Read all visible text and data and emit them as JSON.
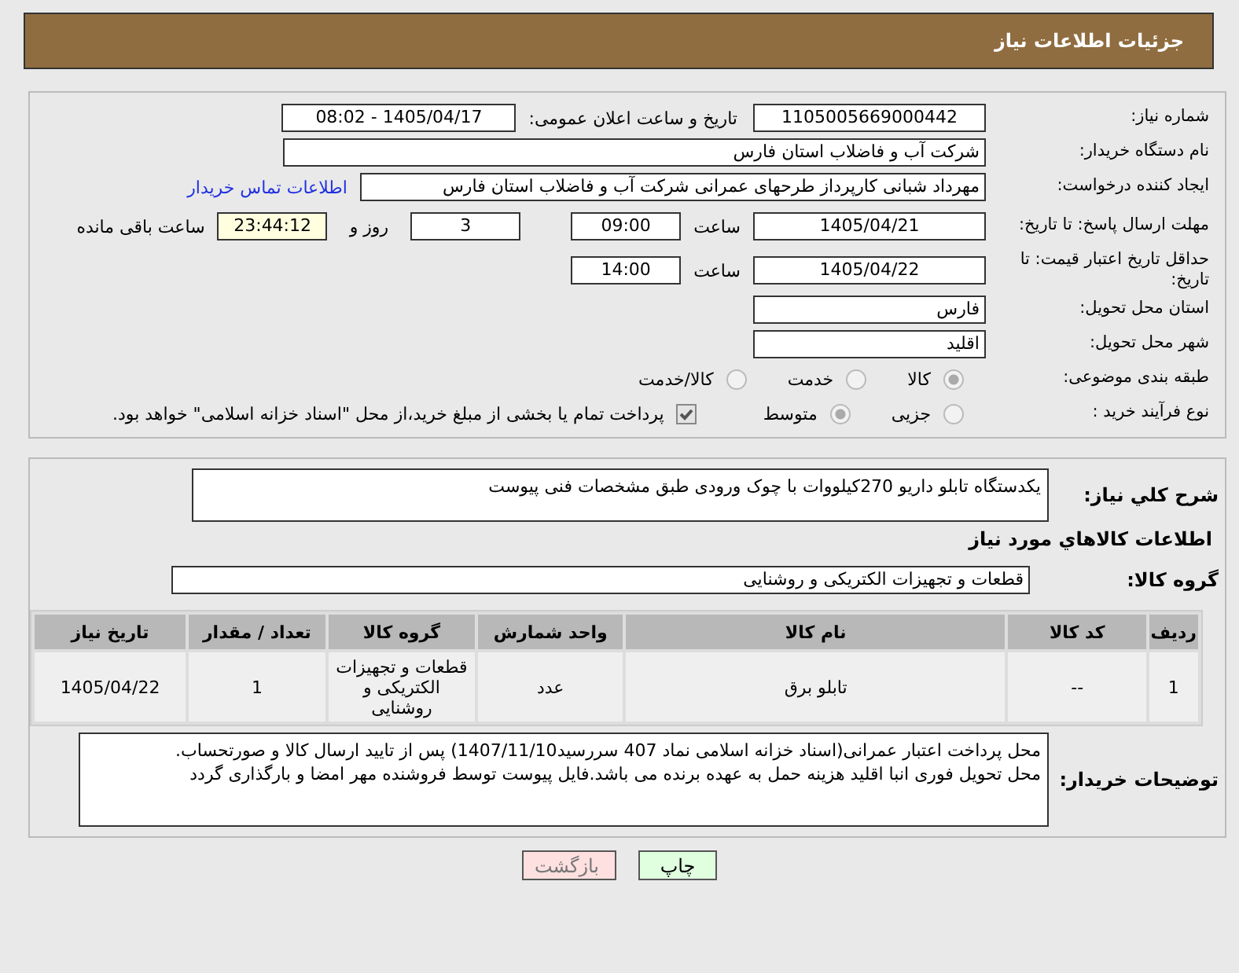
{
  "header": {
    "title": "جزئیات اطلاعات نیاز"
  },
  "need_number": {
    "label": "شماره نیاز:",
    "value": "1105005669000442"
  },
  "announce": {
    "label": "تاریخ و ساعت اعلان عمومی:",
    "value": "1405/04/17 - 08:02"
  },
  "buyer_org": {
    "label": "نام دستگاه خریدار:",
    "value": "شرکت آب و فاضلاب استان فارس"
  },
  "creator": {
    "label": "ایجاد کننده درخواست:",
    "value": "مهرداد شبانی کارپرداز طرحهای عمرانی  شرکت آب و فاضلاب استان فارس",
    "link": "اطلاعات تماس خریدار"
  },
  "response_deadline": {
    "label": "مهلت ارسال پاسخ: تا تاریخ:",
    "date": "1405/04/21",
    "time_label": "ساعت",
    "time": "09:00",
    "days": "3",
    "days_label": "روز و",
    "remaining": "23:44:12",
    "remaining_label": "ساعت باقی مانده"
  },
  "price_validity": {
    "label": "حداقل تاریخ اعتبار قیمت: تا تاریخ:",
    "date": "1405/04/22",
    "time_label": "ساعت",
    "time": "14:00"
  },
  "province": {
    "label": "استان محل تحویل:",
    "value": "فارس"
  },
  "city": {
    "label": "شهر محل تحویل:",
    "value": "اقلید"
  },
  "category": {
    "label": "طبقه بندی موضوعی:",
    "options": [
      {
        "label": "کالا",
        "selected": true
      },
      {
        "label": "خدمت",
        "selected": false
      },
      {
        "label": "کالا/خدمت",
        "selected": false
      }
    ]
  },
  "process": {
    "label": "نوع فرآیند خرید :",
    "options": [
      {
        "label": "جزیی",
        "selected": false
      },
      {
        "label": "متوسط",
        "selected": true
      }
    ],
    "payment": {
      "label": "پرداخت تمام یا بخشی از مبلغ خرید،از محل \"اسناد خزانه اسلامی\" خواهد بود.",
      "checked": true
    }
  },
  "description": {
    "label": "شرح کلي نياز:",
    "value": "یکدستگاه تابلو داریو 270کیلووات با چوک ورودی طبق مشخصات فنی پیوست"
  },
  "goods_title": "اطلاعات کالاهاي مورد نياز",
  "goods_group": {
    "label": "گروه کالا:",
    "value": "قطعات و تجهیزات الکتریکی و روشنایی"
  },
  "table": {
    "columns": [
      "ردیف",
      "کد کالا",
      "نام کالا",
      "واحد شمارش",
      "گروه کالا",
      "تعداد / مقدار",
      "تاریخ نیاز"
    ],
    "rows": [
      [
        "1",
        "--",
        "تابلو برق",
        "عدد",
        "قطعات و تجهیزات الکتریکی و روشنایی",
        "1",
        "1405/04/22"
      ]
    ]
  },
  "buyer_notes": {
    "label": "توضیحات خریدار:",
    "value": "محل پرداخت اعتبار عمرانی(اسناد خزانه اسلامی نماد 407 سررسید1407/11/10) پس از تایید ارسال کالا و صورتحساب.\nمحل تحویل فوری انبا اقلید هزینه حمل به عهده برنده می باشد.فایل پیوست توسط فروشنده مهر امضا و بارگذاری گردد"
  },
  "buttons": [
    {
      "label": "چاپ",
      "kind": "print"
    },
    {
      "label": "بازگشت",
      "kind": "back"
    }
  ]
}
